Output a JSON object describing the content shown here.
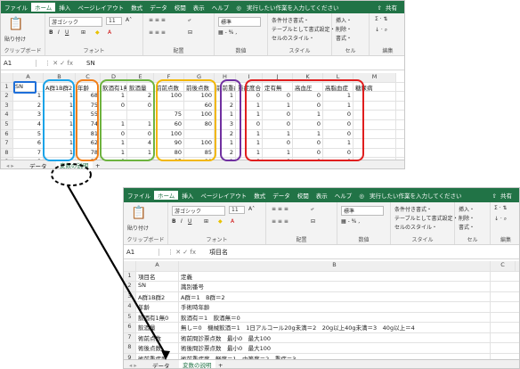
{
  "w1": {
    "menu": [
      "ファイル",
      "ホーム",
      "挿入",
      "ページレイアウト",
      "数式",
      "データ",
      "校閲",
      "表示",
      "ヘルプ",
      "実行したい作業を入力してください",
      "共有"
    ],
    "active_menu": 1,
    "ribbon": {
      "paste": "貼り付け",
      "clipboard": "クリップボード",
      "font_name": "游ゴシック",
      "font_size": "11",
      "font": "フォント",
      "align": "配置",
      "number_fmt": "標準",
      "number": "数値",
      "cond": "条件付き書式・",
      "table": "テーブルとして書式設定・",
      "cellstyle": "セルのスタイル・",
      "style": "スタイル",
      "insert": "挿入・",
      "delete": "削除・",
      "format": "書式・",
      "cell": "セル",
      "edit": "編集"
    },
    "namebox": "A1",
    "fx": "fx",
    "formula": "SN",
    "cols": [
      "A",
      "B",
      "C",
      "D",
      "E",
      "F",
      "G",
      "H",
      "I",
      "J",
      "K",
      "L",
      "M"
    ],
    "rows": [
      [
        "SN",
        "A群1B群2",
        "年齢",
        "飲酒有1無0",
        "飲酒量",
        "前前点数",
        "前後点数",
        "前前重症度",
        "重症度合",
        "定有無",
        "高血圧",
        "高脂血症",
        "糖尿病"
      ],
      [
        "1",
        "1",
        "68",
        "1",
        "2",
        "100",
        "100",
        "1",
        "0",
        "0",
        "0",
        "1",
        ""
      ],
      [
        "2",
        "1",
        "75",
        "0",
        "0",
        "",
        "60",
        "2",
        "1",
        "1",
        "0",
        "1",
        ""
      ],
      [
        "3",
        "1",
        "55",
        "",
        "",
        "75",
        "100",
        "1",
        "1",
        "0",
        "1",
        "0",
        ""
      ],
      [
        "4",
        "1",
        "74",
        "1",
        "1",
        "60",
        "80",
        "3",
        "0",
        "0",
        "0",
        "0",
        ""
      ],
      [
        "5",
        "1",
        "81",
        "0",
        "0",
        "100",
        "",
        "2",
        "1",
        "1",
        "1",
        "0",
        ""
      ],
      [
        "6",
        "1",
        "62",
        "1",
        "4",
        "90",
        "100",
        "1",
        "1",
        "0",
        "0",
        "1",
        ""
      ],
      [
        "7",
        "1",
        "78",
        "1",
        "1",
        "80",
        "85",
        "2",
        "1",
        "1",
        "0",
        "0",
        ""
      ],
      [
        "8",
        "1",
        "54",
        "0",
        "0",
        "95",
        "90",
        "1",
        "0",
        "0",
        "0",
        "0",
        ""
      ]
    ],
    "tabs": [
      "データ",
      "変数の説明"
    ],
    "active_tab": 1,
    "add": "+"
  },
  "w2": {
    "menu": [
      "ファイル",
      "ホーム",
      "挿入",
      "ページレイアウト",
      "数式",
      "データ",
      "校閲",
      "表示",
      "ヘルプ",
      "実行したい作業を入力してください",
      "共有"
    ],
    "active_menu": 1,
    "ribbon": {
      "paste": "貼り付け",
      "clipboard": "クリップボード",
      "font_name": "游ゴシック",
      "font_size": "11",
      "font": "フォント",
      "align": "配置",
      "number_fmt": "標準",
      "number": "数値",
      "cond": "条件付き書式・",
      "table": "テーブルとして書式設定・",
      "cellstyle": "セルのスタイル・",
      "style": "スタイル",
      "insert": "挿入・",
      "delete": "削除・",
      "format": "書式・",
      "cell": "セル",
      "edit": "編集"
    },
    "namebox": "A1",
    "fx": "fx",
    "formula": "項目名",
    "cols": [
      "A",
      "B",
      "C",
      "D"
    ],
    "rows": [
      [
        "項目名",
        "定義"
      ],
      [
        "SN",
        "識別番号"
      ],
      [
        "A群1B群2",
        "A群＝1　B群＝2"
      ],
      [
        "年齢",
        "手術時年齢"
      ],
      [
        "飲酒有1無0",
        "飲酒有＝1　飲酒無＝0"
      ],
      [
        "飲酒量",
        "無し＝0　機械飲酒＝1　1日アルコール20g未満＝2　20g以上40g未満＝3　40g以上＝4"
      ],
      [
        "術前点数",
        "術前問診票点数　最小0　最大100"
      ],
      [
        "術後点数",
        "術後問診票点数　最小0　最大100"
      ],
      [
        "術前重症度",
        "術前重症度　軽度＝1　中等度＝2　重症＝3"
      ]
    ],
    "tabs": [
      "データ",
      "変数の説明"
    ],
    "active_tab": 1,
    "add": "+"
  },
  "colors": {
    "excel_green": "#217346",
    "blue": "#1e6fd9",
    "cyan": "#1aa3e8",
    "orange": "#f07f1a",
    "green": "#6db33f",
    "yellow": "#f2b705",
    "purple": "#7030a0",
    "red": "#e01e1e"
  }
}
